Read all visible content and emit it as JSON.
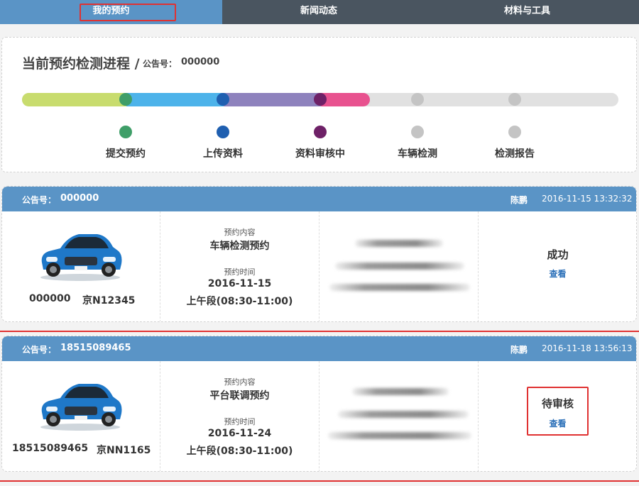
{
  "nav": {
    "tabs": [
      {
        "label": "我的预约",
        "active": true
      },
      {
        "label": "新闻动态",
        "active": false
      },
      {
        "label": "材料与工具",
        "active": false
      }
    ]
  },
  "progress": {
    "title": "当前预约检测进程 /",
    "notice_label": "公告号：",
    "notice_value": "000000",
    "steps": [
      {
        "label": "提交预约",
        "color": "#3f9e68"
      },
      {
        "label": "上传资料",
        "color": "#1f5fb0"
      },
      {
        "label": "资料审核中",
        "color": "#6e2167"
      },
      {
        "label": "车辆检测",
        "color": "#c4c4c4"
      },
      {
        "label": "检测报告",
        "color": "#c4c4c4"
      }
    ],
    "segment_colors": [
      "#c8dc6e",
      "#4db3ea",
      "#8e82bd",
      "#e8528f"
    ],
    "completed_fraction": 0.58
  },
  "orders": [
    {
      "notice_label": "公告号：",
      "notice_value": "000000",
      "person": "陈鹏",
      "datetime": "2016-11-15 13:32:32",
      "vehicle_id": "000000",
      "plate": "京N12345",
      "content_label": "预约内容",
      "content_value": "车辆检测预约",
      "time_label": "预约时间",
      "date_value": "2016-11-15",
      "slot_value": "上午段(08:30-11:00)",
      "status": "成功",
      "view_label": "查看"
    },
    {
      "notice_label": "公告号：",
      "notice_value": "18515089465",
      "person": "陈鹏",
      "datetime": "2016-11-18 13:56:13",
      "vehicle_id": "18515089465",
      "plate": "京NN1165",
      "content_label": "预约内容",
      "content_value": "平台联调预约",
      "time_label": "预约时间",
      "date_value": "2016-11-24",
      "slot_value": "上午段(08:30-11:00)",
      "status": "待审核",
      "view_label": "查看"
    }
  ],
  "colors": {
    "nav_bg": "#4a5560",
    "accent": "#5a94c6",
    "link": "#2a6fb8",
    "highlight": "#e03131"
  }
}
